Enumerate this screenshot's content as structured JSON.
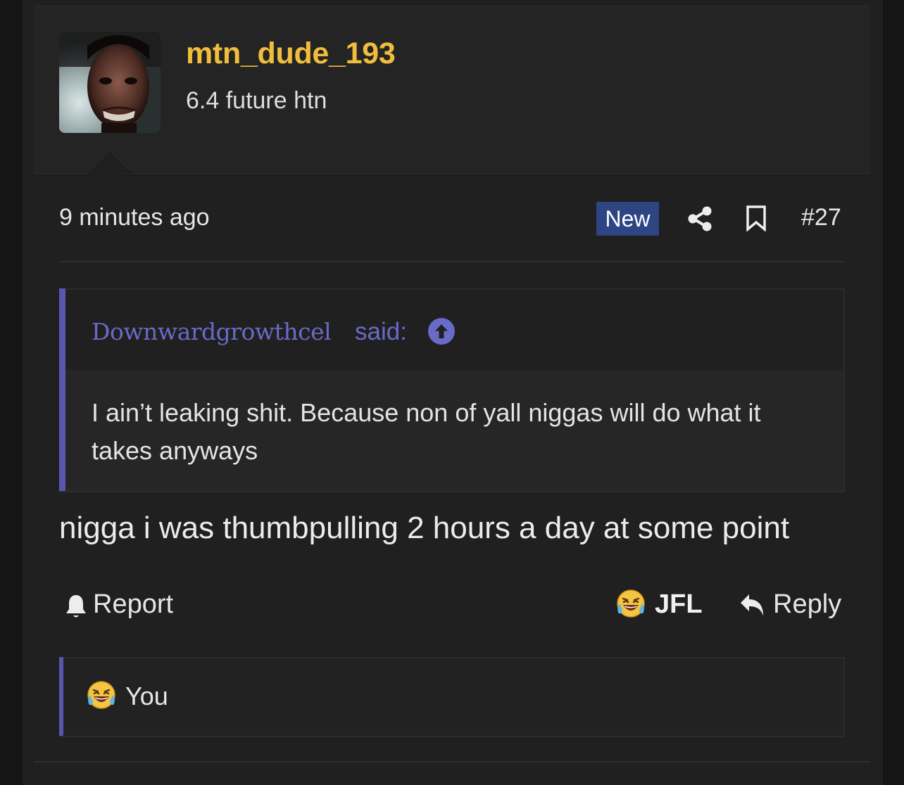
{
  "author": {
    "username": "mtn_dude_193",
    "user_title": "6.4 future htn",
    "avatar_icon": "user-avatar-photo"
  },
  "post_meta": {
    "timestamp": "9 minutes ago",
    "new_badge": "New",
    "post_number": "#27",
    "icons": [
      "share-icon",
      "bookmark-icon"
    ]
  },
  "quote": {
    "author": "Downwardgrowthcel",
    "said_label": "said:",
    "body": "I ain’t leaking shit. Because non of yall niggas will do what it takes anyways"
  },
  "post": {
    "body": "nigga i was thumbpulling 2 hours a day at some point"
  },
  "actions": {
    "report_label": "Report",
    "jfl_label": "JFL",
    "reply_label": "Reply"
  },
  "reactions": {
    "users": [
      "You"
    ]
  },
  "colors": {
    "username": "#f0bd3c",
    "accent": "#5757b2",
    "quote_author": "#6a6ac7",
    "new_badge": "#2d4683"
  }
}
